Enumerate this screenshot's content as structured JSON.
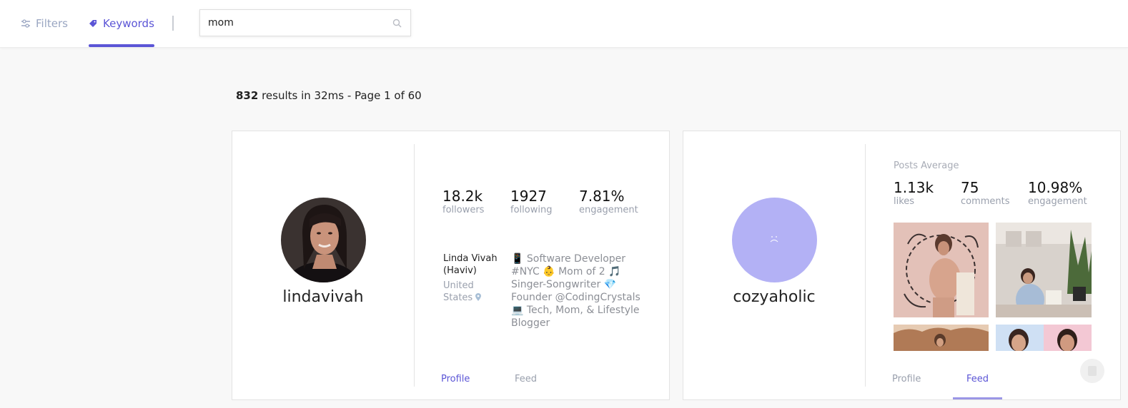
{
  "nav": {
    "filters_label": "Filters",
    "keywords_label": "Keywords"
  },
  "search": {
    "value": "mom"
  },
  "results": {
    "count": "832",
    "summary": "results in 32ms - Page 1 of 60"
  },
  "cards": [
    {
      "username": "lindavivah",
      "stats": [
        {
          "value": "18.2k",
          "label": "followers"
        },
        {
          "value": "1927",
          "label": "following"
        },
        {
          "value": "7.81%",
          "label": "engagement"
        }
      ],
      "name": "Linda Vivah (Haviv)",
      "location": "United States",
      "bio": "📱 Software Developer #NYC 👶 Mom of 2 🎵 Singer-Songwriter 💎 Founder @CodingCrystals 💻 Tech, Mom, & Lifestyle Blogger",
      "tabs": {
        "profile": "Profile",
        "feed": "Feed"
      },
      "active_tab": "profile"
    },
    {
      "username": "cozyaholic",
      "posts_average_label": "Posts Average",
      "stats": [
        {
          "value": "1.13k",
          "label": "likes"
        },
        {
          "value": "75",
          "label": "comments"
        },
        {
          "value": "10.98%",
          "label": "engagement"
        }
      ],
      "tabs": {
        "profile": "Profile",
        "feed": "Feed"
      },
      "active_tab": "feed",
      "avatar_color": "#b3b1f5"
    }
  ],
  "colors": {
    "accent": "#5b55d6",
    "muted": "#9aa0ad",
    "background": "#f8f8f8"
  }
}
